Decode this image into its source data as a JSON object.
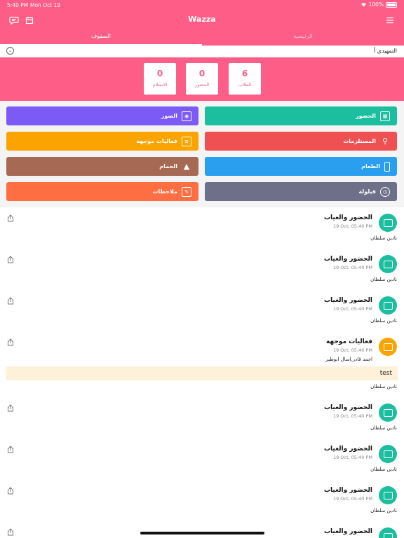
{
  "status_bar": {
    "time": "5:40 PM",
    "date": "Mon Oct 19",
    "battery": "100%"
  },
  "header": {
    "title": "Wazza"
  },
  "tabs": [
    {
      "label": "الرئيسية",
      "active": false
    },
    {
      "label": "الصفوف",
      "active": true
    }
  ],
  "class_selector": {
    "label": "التمهيدي أ"
  },
  "stats": [
    {
      "value": "6",
      "label": "الطلاب"
    },
    {
      "value": "0",
      "label": "الحضور"
    },
    {
      "value": "0",
      "label": "الاستلام"
    }
  ],
  "actions": [
    {
      "label": "الحضور",
      "color": "#1bbf9f",
      "icon": "attendance-icon"
    },
    {
      "label": "الصور",
      "color": "#7b5af5",
      "icon": "camera-icon"
    },
    {
      "label": "المستلزمات",
      "color": "#ef5052",
      "icon": "search-icon"
    },
    {
      "label": "فعاليات موجهة",
      "color": "#fba400",
      "icon": "activity-icon"
    },
    {
      "label": "الطعام",
      "color": "#2a9ff0",
      "icon": "bottle-icon"
    },
    {
      "label": "الحمام",
      "color": "#a66a54",
      "icon": "potty-icon"
    },
    {
      "label": "قيلولة",
      "color": "#6d7088",
      "icon": "alarm-icon"
    },
    {
      "label": "ملاحظات",
      "color": "#fd6e43",
      "icon": "note-icon"
    }
  ],
  "feed": [
    {
      "title": "الحضور والغياب",
      "time": "19 Oct, 05:40 PM",
      "author": "نادين سلطان",
      "avatar_color": "#1bbf9f"
    },
    {
      "title": "الحضور والغياب",
      "time": "19 Oct, 05:40 PM",
      "author": "نادين سلطان",
      "avatar_color": "#1bbf9f"
    },
    {
      "title": "الحضور والغياب",
      "time": "19 Oct, 05:40 PM",
      "author": "نادين سلطان",
      "avatar_color": "#1bbf9f"
    },
    {
      "title": "فعاليات موجهة",
      "time": "19 Oct, 05:40 PM",
      "students": "احمد قادر,اسال ابوطير",
      "note": "test",
      "author": "نادين سلطان",
      "avatar_color": "#fba400"
    },
    {
      "title": "الحضور والغياب",
      "time": "19 Oct, 05:40 PM",
      "author": "نادين سلطان",
      "avatar_color": "#1bbf9f"
    },
    {
      "title": "الحضور والغياب",
      "time": "19 Oct, 05:40 PM",
      "author": "نادين سلطان",
      "avatar_color": "#1bbf9f"
    },
    {
      "title": "الحضور والغياب",
      "time": "19 Oct, 05:40 PM",
      "author": "نادين سلطان",
      "avatar_color": "#1bbf9f"
    },
    {
      "title": "الحضور والغياب",
      "time": "",
      "author": "",
      "avatar_color": "#1bbf9f"
    }
  ],
  "colors": {
    "brand": "#fd5d86"
  }
}
